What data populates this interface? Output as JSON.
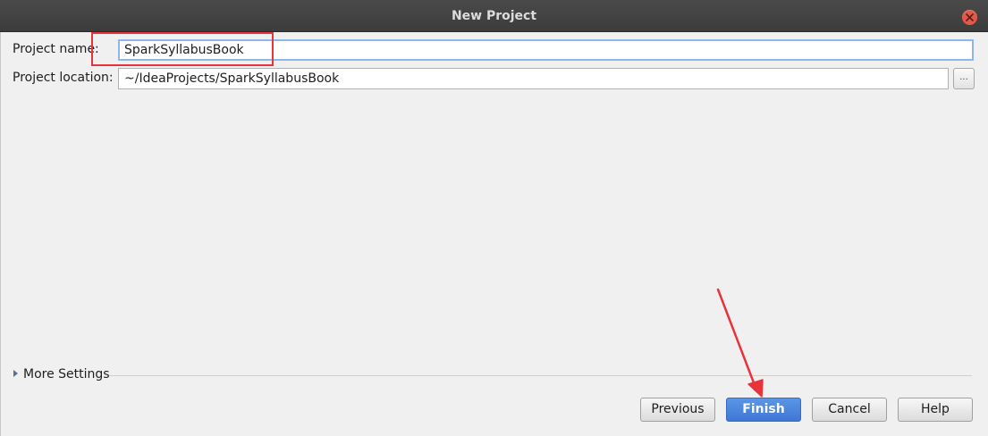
{
  "window": {
    "title": "New Project"
  },
  "form": {
    "project_name": {
      "label": "Project name:",
      "value": "SparkSyllabusBook"
    },
    "project_location": {
      "label": "Project location:",
      "value": "~/IdeaProjects/SparkSyllabusBook",
      "browse_label": "..."
    }
  },
  "more_settings": {
    "label": "More Settings"
  },
  "buttons": {
    "previous": "Previous",
    "finish": "Finish",
    "cancel": "Cancel",
    "help": "Help"
  },
  "colors": {
    "titlebar": "#3c3c3c",
    "close_button": "#e2594a",
    "primary_button": "#4a84da",
    "annotation_red": "#e8333a",
    "input_focus": "#8fb8e8"
  },
  "icons": {
    "close": "close-icon",
    "disclosure": "triangle-right-icon",
    "annotation": "arrow-annotation"
  }
}
